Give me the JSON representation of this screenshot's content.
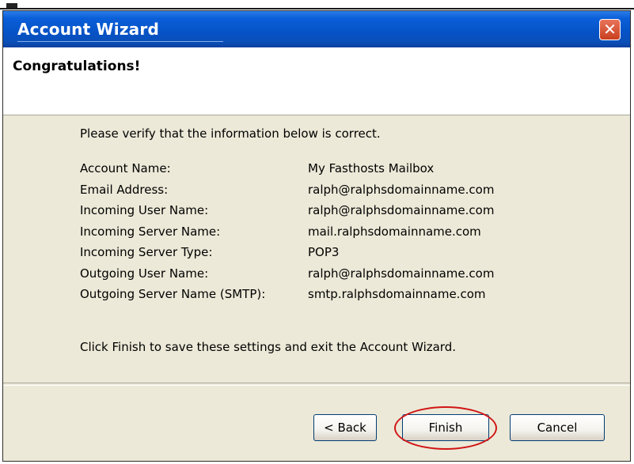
{
  "window": {
    "title": "Account Wizard",
    "close_glyph": "✕"
  },
  "header": {
    "title": "Congratulations!"
  },
  "content": {
    "intro": "Please verify that the information below is correct.",
    "fields": [
      {
        "label": "Account Name:",
        "value": "My Fasthosts Mailbox"
      },
      {
        "label": "Email Address:",
        "value": "ralph@ralphsdomainname.com"
      },
      {
        "label": "Incoming User Name:",
        "value": "ralph@ralphsdomainname.com"
      },
      {
        "label": "Incoming Server Name:",
        "value": "mail.ralphsdomainname.com"
      },
      {
        "label": "Incoming Server Type:",
        "value": "POP3"
      },
      {
        "label": "Outgoing User Name:",
        "value": "ralph@ralphsdomainname.com"
      },
      {
        "label": "Outgoing Server Name (SMTP):",
        "value": "smtp.ralphsdomainname.com"
      }
    ],
    "outro": "Click Finish to save these settings and exit the Account Wizard."
  },
  "buttons": {
    "back": "< Back",
    "finish": "Finish",
    "cancel": "Cancel"
  },
  "colors": {
    "titlebar": "#0652c6",
    "dialog_bg": "#ece9d8",
    "highlight": "#d11515",
    "close_button": "#c8401f"
  }
}
